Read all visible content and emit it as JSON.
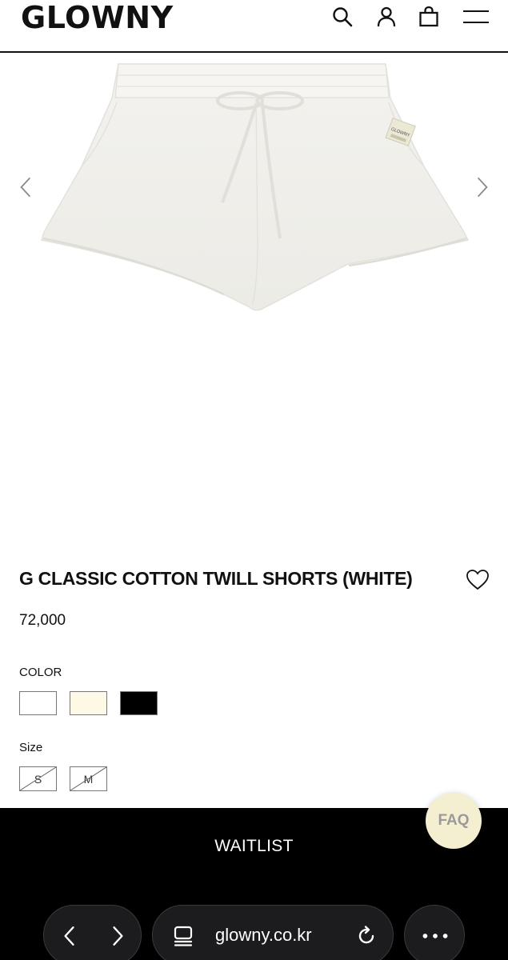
{
  "header": {
    "logo": "GLOWNY",
    "icons": [
      "search-icon",
      "user-icon",
      "bag-icon",
      "menu-icon"
    ]
  },
  "product": {
    "title": "G CLASSIC COTTON TWILL SHORTS (WHITE)",
    "price": "72,000",
    "color_label": "COLOR",
    "colors": [
      {
        "name": "white",
        "hex": "#ffffff"
      },
      {
        "name": "cream",
        "hex": "#fdf9e6"
      },
      {
        "name": "black",
        "hex": "#000000"
      }
    ],
    "size_label": "Size",
    "sizes": [
      {
        "label": "S",
        "available": false
      },
      {
        "label": "M",
        "available": false
      }
    ],
    "patch_text": "GLOWNY"
  },
  "cta": {
    "label": "WAITLIST"
  },
  "faq": {
    "label": "FAQ"
  },
  "browser": {
    "url": "glowny.co.kr"
  },
  "colors": {
    "cta_bg": "#000000",
    "faq_bg": "#f5efd2",
    "browser_pill": "#1c1c1e"
  }
}
